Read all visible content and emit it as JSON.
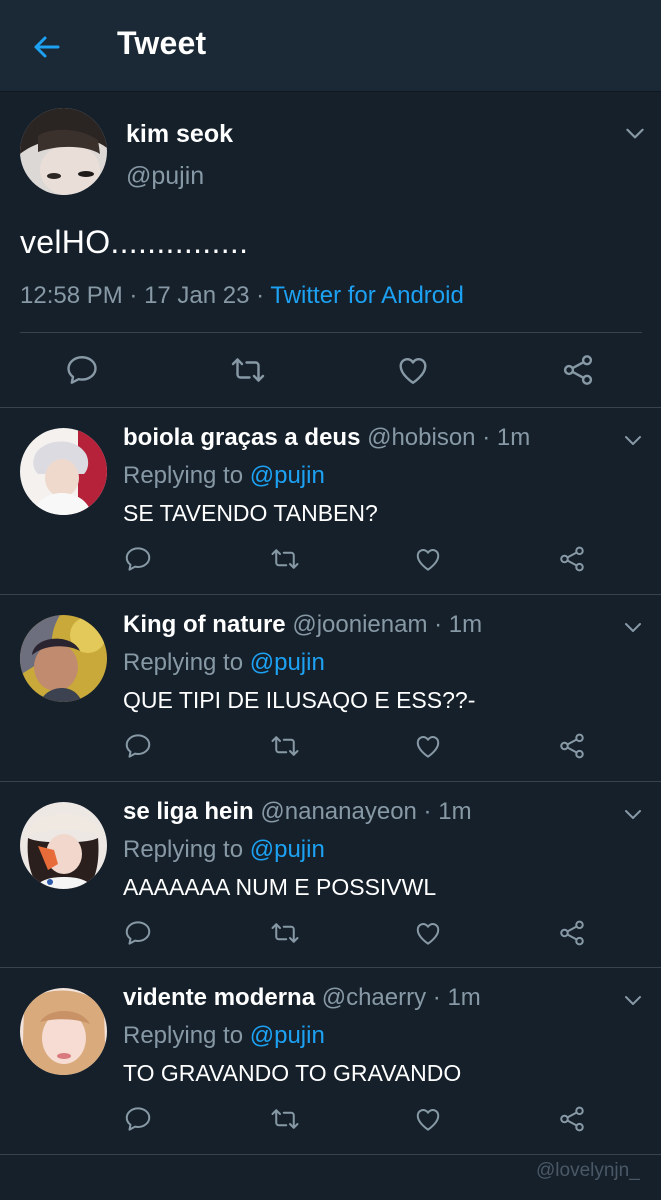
{
  "header": {
    "title": "Tweet",
    "back_icon": "arrow-left-icon",
    "accent": "#1da1f2"
  },
  "tweet": {
    "author_name": "kim seok",
    "author_handle": "@pujin",
    "text": "velHO...............",
    "time": "12:58 PM",
    "date": "17 Jan 23",
    "source": "Twitter for Android",
    "meta_sep": " · "
  },
  "actions": {
    "reply_icon": "reply-icon",
    "retweet_icon": "retweet-icon",
    "like_icon": "heart-icon",
    "share_icon": "share-icon"
  },
  "replies": [
    {
      "name": "boiola graças a deus",
      "handle": "@hobison",
      "time": "1m",
      "replying_prefix": "Replying to ",
      "replying_to": "@pujin",
      "text": "SE TAVENDO TANBEN?"
    },
    {
      "name": "King of nature",
      "handle": "@joonienam",
      "time": "1m",
      "replying_prefix": "Replying to ",
      "replying_to": "@pujin",
      "text": "QUE TIPI DE ILUSAQO E ESS??-"
    },
    {
      "name": "se liga hein",
      "handle": "@nananayeon",
      "time": "1m",
      "replying_prefix": "Replying to ",
      "replying_to": "@pujin",
      "text": "AAAAAAA NUM E POSSIVWL"
    },
    {
      "name": "vidente moderna",
      "handle": "@chaerry",
      "time": "1m",
      "replying_prefix": "Replying to ",
      "replying_to": "@pujin",
      "text": "TO GRAVANDO TO GRAVANDO"
    }
  ],
  "dot_sep": " · ",
  "watermark": "@lovelynjn_"
}
